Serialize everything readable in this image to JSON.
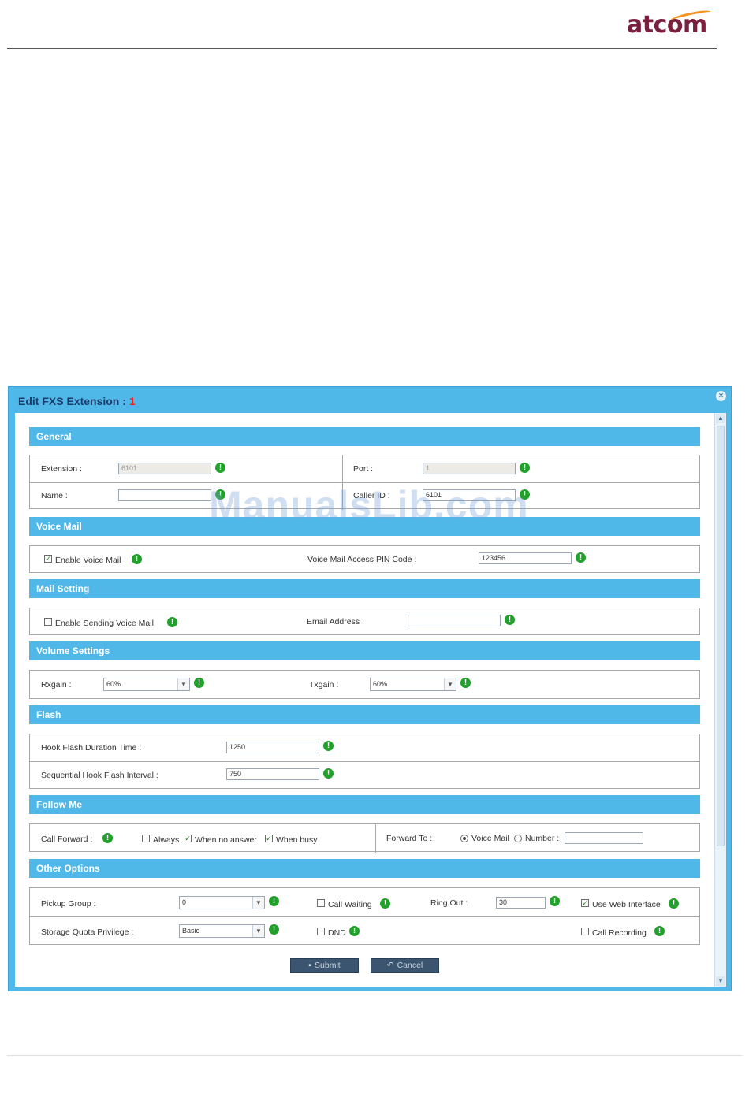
{
  "brand": {
    "logo_text": "atcom"
  },
  "dialog": {
    "title": "Edit FXS Extension",
    "title_sep": " : ",
    "title_number": "1",
    "close_icon": "close-icon"
  },
  "general": {
    "heading": "General",
    "extension_label": "Extension :",
    "extension_value": "6101",
    "port_label": "Port :",
    "port_value": "1",
    "name_label": "Name :",
    "name_value": "",
    "callerid_label": "Caller ID :",
    "callerid_value": "6101"
  },
  "voicemail": {
    "heading": "Voice Mail",
    "enable_label": "Enable Voice Mail",
    "enable_checked": true,
    "pin_label": "Voice Mail Access PIN Code :",
    "pin_value": "123456"
  },
  "mail": {
    "heading": "Mail Setting",
    "enable_label": "Enable Sending Voice Mail",
    "enable_checked": false,
    "email_label": "Email Address :",
    "email_value": ""
  },
  "volume": {
    "heading": "Volume  Settings",
    "rx_label": "Rxgain :",
    "rx_value": "60%",
    "tx_label": "Txgain :",
    "tx_value": "60%"
  },
  "flash": {
    "heading": "Flash",
    "duration_label": "Hook Flash Duration Time :",
    "duration_value": "1250",
    "interval_label": "Sequential Hook Flash Interval :",
    "interval_value": "750"
  },
  "followme": {
    "heading": "Follow Me",
    "callforward_label": "Call Forward :",
    "always_label": "Always",
    "noanswer_label": "When no answer",
    "busy_label": "When busy",
    "forwardto_label": "Forward To :",
    "voicemail_label": "Voice Mail",
    "number_label": "Number :",
    "number_value": ""
  },
  "other": {
    "heading": "Other Options",
    "pickup_label": "Pickup Group :",
    "pickup_value": "0",
    "callwaiting_label": "Call Waiting",
    "ringout_label": "Ring Out :",
    "ringout_value": "30",
    "webinterface_label": "Use Web Interface",
    "quota_label": "Storage Quota Privilege :",
    "quota_value": "Basic",
    "dnd_label": "DND",
    "recording_label": "Call Recording"
  },
  "buttons": {
    "submit": "Submit",
    "cancel": "Cancel"
  },
  "watermark": "ManualsLib.com",
  "colors": {
    "header": "#4fb8e8",
    "help": "#22a02c",
    "title_number": "#e8201a",
    "button": "#3b5570"
  }
}
